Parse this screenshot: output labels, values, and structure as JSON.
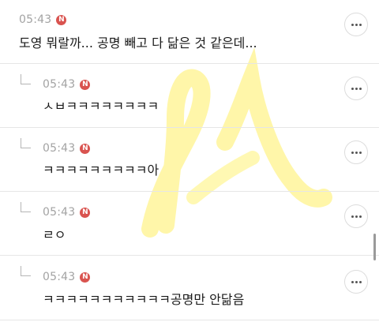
{
  "comments": [
    {
      "time": "05:43",
      "badge": "N",
      "text": "도영 뭐랄까... 공명 빼고 다 닮은 것 같은데..."
    },
    {
      "time": "05:43",
      "badge": "N",
      "text": "ㅅㅂㅋㅋㅋㅋㅋㅋㅋㅋ"
    },
    {
      "time": "05:43",
      "badge": "N",
      "text": "ㅋㅋㅋㅋㅋㅋㅋㅋㅋ아"
    },
    {
      "time": "05:43",
      "badge": "N",
      "text": "ㄹㅇ"
    },
    {
      "time": "05:43",
      "badge": "N",
      "text": "ㅋㅋㅋㅋㅋㅋㅋㅋㅋㅋㅋ공명만 안닮음"
    }
  ],
  "watermark_color": "#fff59a"
}
